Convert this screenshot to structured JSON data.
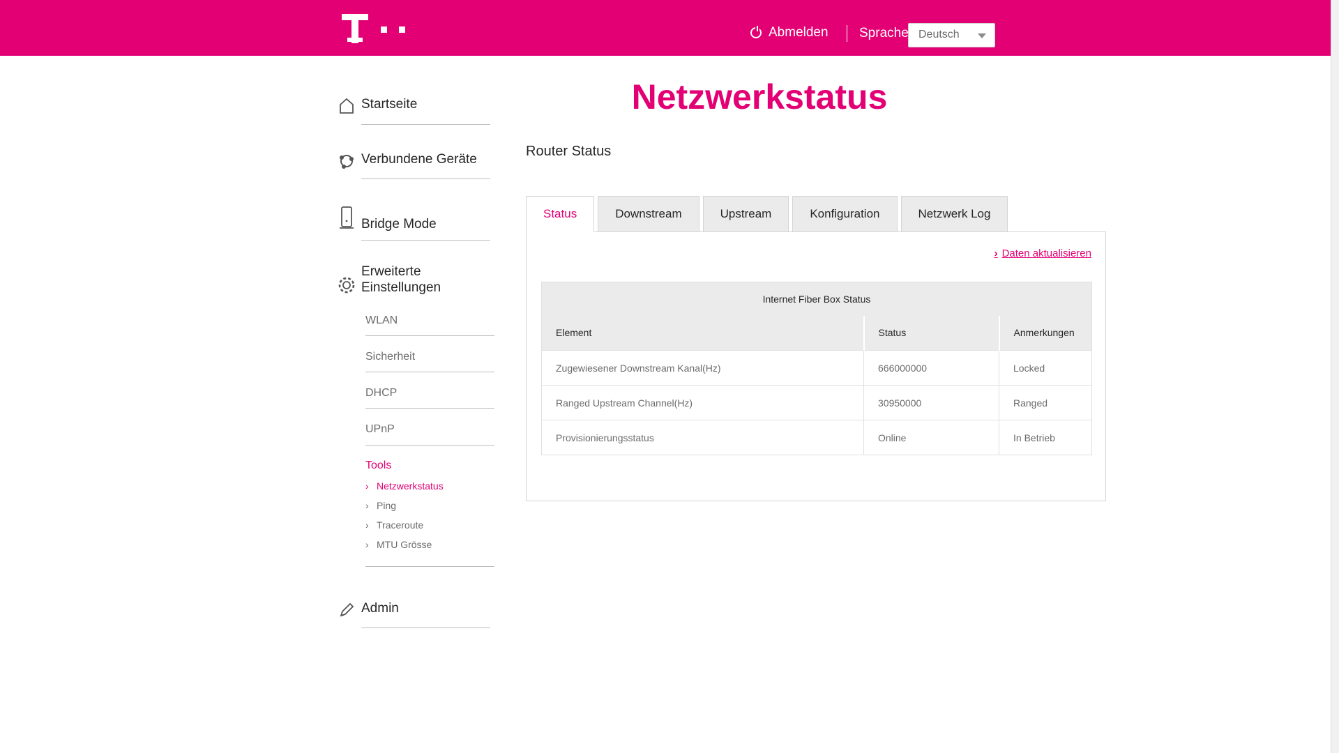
{
  "header": {
    "logout_label": "Abmelden",
    "language_label": "Sprache",
    "language_selected": "Deutsch",
    "brand_color": "#e20074"
  },
  "sidebar": {
    "items": [
      {
        "label": "Startseite",
        "icon": "home-icon"
      },
      {
        "label": "Verbundene Geräte",
        "icon": "devices-icon"
      },
      {
        "label": "Bridge Mode",
        "icon": "router-icon"
      },
      {
        "label_line1": "Erweiterte",
        "label_line2": "Einstellungen",
        "icon": "gear-icon"
      },
      {
        "label": "Admin",
        "icon": "pencil-icon"
      }
    ],
    "advanced": [
      "WLAN",
      "Sicherheit",
      "DHCP",
      "UPnP",
      "Tools"
    ],
    "tools": [
      "Netzwerkstatus",
      "Ping",
      "Traceroute",
      "MTU Grösse"
    ]
  },
  "main": {
    "title": "Netzwerkstatus",
    "section": "Router Status",
    "tabs": [
      "Status",
      "Downstream",
      "Upstream",
      "Konfiguration",
      "Netzwerk Log"
    ],
    "refresh_label": "Daten aktualisieren",
    "table": {
      "caption": "Internet Fiber Box Status",
      "headers": [
        "Element",
        "Status",
        "Anmerkungen"
      ],
      "rows": [
        [
          "Zugewiesener Downstream Kanal(Hz)",
          "666000000",
          "Locked"
        ],
        [
          "Ranged Upstream Channel(Hz)",
          "30950000",
          "Ranged"
        ],
        [
          "Provisionierungsstatus",
          "Online",
          "In Betrieb"
        ]
      ]
    }
  }
}
